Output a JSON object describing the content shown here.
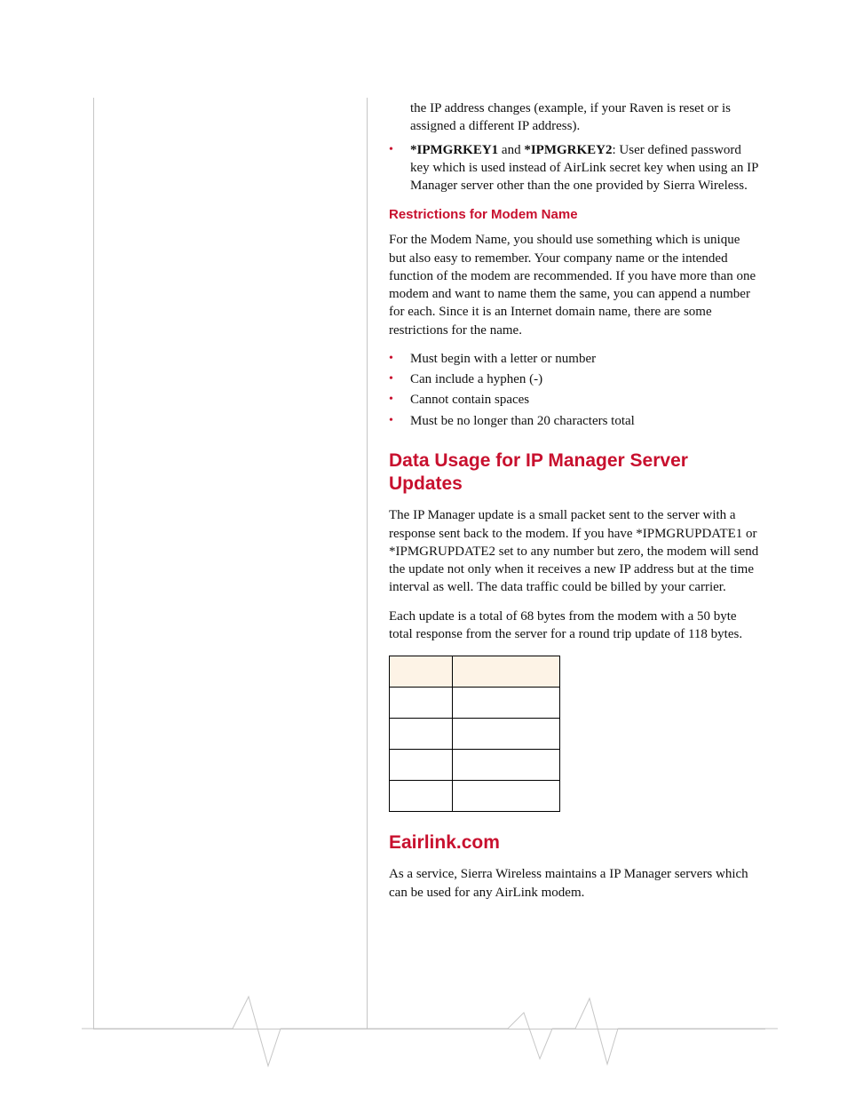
{
  "intro_continued": "the IP address changes (example, if your Raven is reset or is assigned a different IP address).",
  "bullet_key": {
    "bold_a": "*IPMGRKEY1",
    "mid": " and ",
    "bold_b": "*IPMGRKEY2",
    "rest": ": User defined password key which is used instead of AirLink secret key when using an IP Manager server other than the one provided by Sierra Wireless."
  },
  "restrictions_heading": "Restrictions for Modem Name",
  "restrictions_para": "For the Modem Name, you should use something which is unique but also easy to remember. Your company name or the intended function of the modem are recommended. If you have more than one modem and want to name them the same, you can append a number for each. Since it is an Internet domain name, there are some restrictions for the name.",
  "restrictions_list": [
    "Must begin with a letter or number",
    "Can include a hyphen (-)",
    "Cannot contain spaces",
    "Must be no longer than 20 characters total"
  ],
  "data_usage_heading": "Data Usage for IP Manager Server Updates",
  "data_usage_p1": "The IP Manager update is a small packet sent to the server with a response sent back to the modem. If you have *IPMGRUPDATE1 or *IPMGRUPDATE2 set to any number but zero, the modem will send the update not only when it receives a new IP address but at the time interval as well. The data traffic could be billed by your carrier.",
  "data_usage_p2": "Each update is a total of 68 bytes from the modem with a 50 byte total response from the server for a round trip update of 118 bytes.",
  "eairlink_heading": "Eairlink.com",
  "eairlink_para": "As a service, Sierra Wireless  maintains a IP Manager servers which can be used for any AirLink modem.",
  "table": {
    "headers": [
      "",
      ""
    ],
    "rows": [
      [
        "",
        ""
      ],
      [
        "",
        ""
      ],
      [
        "",
        ""
      ],
      [
        "",
        ""
      ]
    ]
  }
}
